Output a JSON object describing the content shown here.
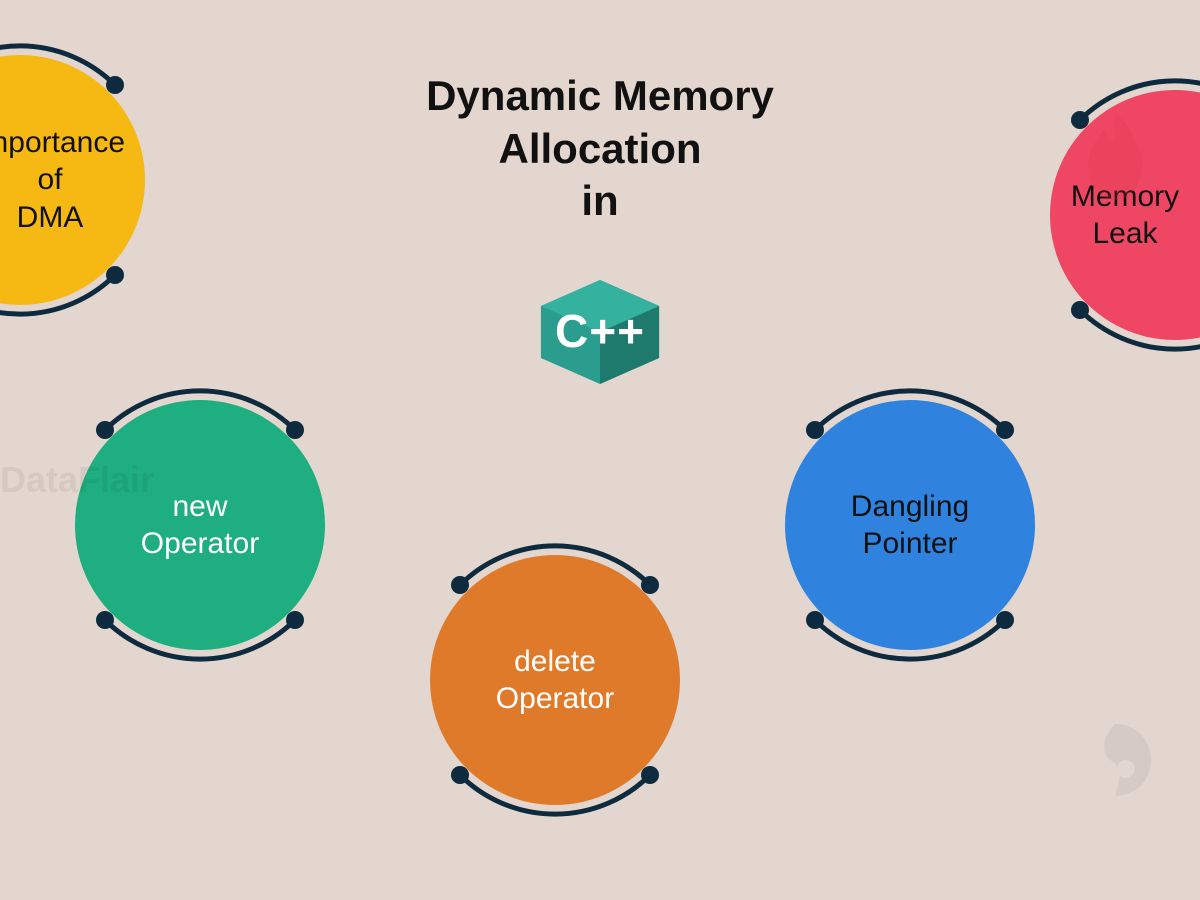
{
  "title": {
    "line1": "Dynamic Memory",
    "line2": "Allocation",
    "line3": "in"
  },
  "logo": {
    "text": "C++",
    "color_main": "#2a9d8f",
    "color_shade": "#1f7a6e"
  },
  "bubbles": {
    "yellow": {
      "line1": "Importance",
      "line2": "of",
      "line3": "DMA",
      "color": "#f6b813"
    },
    "green": {
      "line1": "new",
      "line2": "Operator",
      "color": "#1fae7f"
    },
    "orange": {
      "line1": "delete",
      "line2": "Operator",
      "color": "#e07a2b"
    },
    "blue": {
      "line1": "Dangling",
      "line2": "Pointer",
      "color": "#2f83de"
    },
    "pink": {
      "line1": "Memory",
      "line2": "Leak",
      "color": "#ef4663"
    }
  },
  "arc": {
    "stroke": "#0e2a3f",
    "width": 5,
    "dot_r": 9
  },
  "watermark": {
    "text": "DataFlair"
  }
}
